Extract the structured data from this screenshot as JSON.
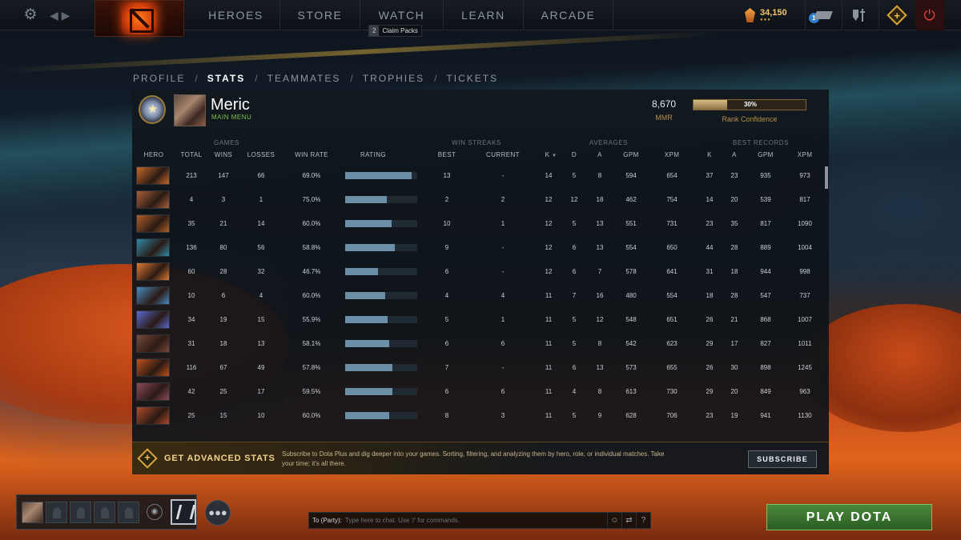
{
  "topbar": {
    "nav": [
      "HEROES",
      "STORE",
      "WATCH",
      "LEARN",
      "ARCADE"
    ],
    "claim_count": "2",
    "claim_label": "Claim Packs",
    "shards": "34,150",
    "shard_dots": "●●●",
    "mail_badge": "1",
    "power_symbol": "⏻"
  },
  "crumbs": [
    "PROFILE",
    "STATS",
    "TEAMMATES",
    "TROPHIES",
    "TICKETS"
  ],
  "crumb_sep": "/",
  "profile": {
    "name": "Meric",
    "status": "MAIN MENU",
    "mmr": "8,670",
    "mmr_label": "MMR",
    "confidence_label": "30%",
    "confidence_value": 0.3,
    "confidence_caption": "Rank Confidence"
  },
  "groups": {
    "games": "GAMES",
    "streaks": "WIN STREAKS",
    "averages": "AVERAGES",
    "records": "BEST RECORDS"
  },
  "columns": {
    "hero": "HERO",
    "total": "TOTAL",
    "wins": "WINS",
    "losses": "LOSSES",
    "winrate": "WIN RATE",
    "rating": "RATING",
    "best": "BEST",
    "current": "CURRENT",
    "k": "K",
    "d": "D",
    "a": "A",
    "gpm": "GPM",
    "xpm": "XPM",
    "rk": "K",
    "ra": "A",
    "rgpm": "GPM",
    "rxpm": "XPM"
  },
  "rows": [
    {
      "hero_color": "#c86a2a",
      "total": "213",
      "wins": "147",
      "losses": "66",
      "winrate": "69.0%",
      "rating": 0.92,
      "best": "13",
      "current": "-",
      "k": "14",
      "d": "5",
      "a": "8",
      "gpm": "594",
      "xpm": "654",
      "rk": "37",
      "ra": "23",
      "rgpm": "935",
      "rxpm": "973"
    },
    {
      "hero_color": "#a8603a",
      "total": "4",
      "wins": "3",
      "losses": "1",
      "winrate": "75.0%",
      "rating": 0.58,
      "best": "2",
      "current": "2",
      "k": "12",
      "d": "12",
      "a": "18",
      "gpm": "462",
      "xpm": "754",
      "rk": "14",
      "ra": "20",
      "rgpm": "539",
      "rxpm": "817"
    },
    {
      "hero_color": "#b0602a",
      "total": "35",
      "wins": "21",
      "losses": "14",
      "winrate": "60.0%",
      "rating": 0.64,
      "best": "10",
      "current": "1",
      "k": "12",
      "d": "5",
      "a": "13",
      "gpm": "551",
      "xpm": "731",
      "rk": "23",
      "ra": "35",
      "rgpm": "817",
      "rxpm": "1090"
    },
    {
      "hero_color": "#2f8aa8",
      "total": "136",
      "wins": "80",
      "losses": "56",
      "winrate": "58.8%",
      "rating": 0.69,
      "best": "9",
      "current": "-",
      "k": "12",
      "d": "6",
      "a": "13",
      "gpm": "554",
      "xpm": "650",
      "rk": "44",
      "ra": "28",
      "rgpm": "889",
      "rxpm": "1004"
    },
    {
      "hero_color": "#e07a30",
      "total": "60",
      "wins": "28",
      "losses": "32",
      "winrate": "46.7%",
      "rating": 0.45,
      "best": "6",
      "current": "-",
      "k": "12",
      "d": "6",
      "a": "7",
      "gpm": "578",
      "xpm": "641",
      "rk": "31",
      "ra": "18",
      "rgpm": "944",
      "rxpm": "998"
    },
    {
      "hero_color": "#4a8ac0",
      "total": "10",
      "wins": "6",
      "losses": "4",
      "winrate": "60.0%",
      "rating": 0.56,
      "best": "4",
      "current": "4",
      "k": "11",
      "d": "7",
      "a": "16",
      "gpm": "480",
      "xpm": "554",
      "rk": "18",
      "ra": "28",
      "rgpm": "547",
      "rxpm": "737"
    },
    {
      "hero_color": "#5a6ad0",
      "total": "34",
      "wins": "19",
      "losses": "15",
      "winrate": "55.9%",
      "rating": 0.59,
      "best": "5",
      "current": "1",
      "k": "11",
      "d": "5",
      "a": "12",
      "gpm": "548",
      "xpm": "651",
      "rk": "26",
      "ra": "21",
      "rgpm": "868",
      "rxpm": "1007"
    },
    {
      "hero_color": "#7a4a3a",
      "total": "31",
      "wins": "18",
      "losses": "13",
      "winrate": "58.1%",
      "rating": 0.61,
      "best": "6",
      "current": "6",
      "k": "11",
      "d": "5",
      "a": "8",
      "gpm": "542",
      "xpm": "623",
      "rk": "29",
      "ra": "17",
      "rgpm": "827",
      "rxpm": "1011"
    },
    {
      "hero_color": "#c0501a",
      "total": "116",
      "wins": "67",
      "losses": "49",
      "winrate": "57.8%",
      "rating": 0.66,
      "best": "7",
      "current": "-",
      "k": "11",
      "d": "6",
      "a": "13",
      "gpm": "573",
      "xpm": "655",
      "rk": "26",
      "ra": "30",
      "rgpm": "898",
      "rxpm": "1245"
    },
    {
      "hero_color": "#8a4a5a",
      "total": "42",
      "wins": "25",
      "losses": "17",
      "winrate": "59.5%",
      "rating": 0.65,
      "best": "6",
      "current": "6",
      "k": "11",
      "d": "4",
      "a": "8",
      "gpm": "613",
      "xpm": "730",
      "rk": "29",
      "ra": "20",
      "rgpm": "849",
      "rxpm": "963"
    },
    {
      "hero_color": "#b04a2a",
      "total": "25",
      "wins": "15",
      "losses": "10",
      "winrate": "60.0%",
      "rating": 0.61,
      "best": "8",
      "current": "3",
      "k": "11",
      "d": "5",
      "a": "9",
      "gpm": "628",
      "xpm": "706",
      "rk": "23",
      "ra": "19",
      "rgpm": "941",
      "rxpm": "1130"
    }
  ],
  "banner": {
    "title": "GET ADVANCED STATS",
    "description": "Subscribe to Dota Plus and dig deeper into your games. Sorting, filtering, and analyzing them by hero, role, or individual matches. Take your time; it's all there.",
    "button": "SUBSCRIBE"
  },
  "chat": {
    "label": "To (Party):",
    "placeholder": "Type here to chat. Use '/' for commands.",
    "help": "?"
  },
  "play_button": "PLAY DOTA",
  "icons": {
    "settings": "gear-icon",
    "back": "back-arrow-icon",
    "logo": "dota-logo-icon",
    "shards": "shards-icon",
    "mail": "mail-icon",
    "armory": "armory-icon",
    "dota_plus": "dota-plus-icon",
    "power": "power-icon",
    "emoji": "emoji-icon",
    "chat_options": "chat-options-icon",
    "party_group": "party-group-icon"
  },
  "colors": {
    "accent_gold": "#d8a33a",
    "status_green": "#79c34f",
    "play_green": "#4a8a3c",
    "rating_bar": "#6c8fa8"
  }
}
